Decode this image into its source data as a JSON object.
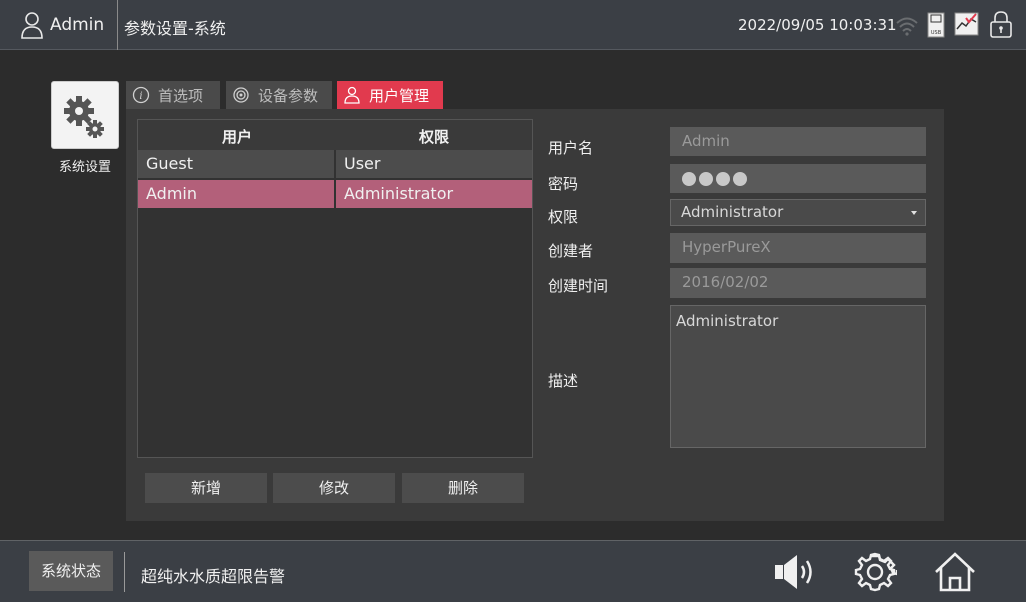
{
  "topbar": {
    "user_name": "Admin",
    "page_title": "参数设置-系统",
    "datetime": "2022/09/05 10:03:31",
    "icons": [
      "user-icon",
      "wifi-icon",
      "usb-icon",
      "chart-check-icon",
      "lock-icon"
    ]
  },
  "app_tile": {
    "label": "系统设置",
    "icon": "gears-icon"
  },
  "tabs": [
    {
      "label": "首选项",
      "icon": "info-icon",
      "active": false
    },
    {
      "label": "设备参数",
      "icon": "gear-icon",
      "active": false
    },
    {
      "label": "用户管理",
      "icon": "user-icon",
      "active": true
    }
  ],
  "table": {
    "headers": [
      "用户",
      "权限"
    ],
    "rows": [
      {
        "user": "Guest",
        "permission": "User",
        "selected": false
      },
      {
        "user": "Admin",
        "permission": "Administrator",
        "selected": true
      }
    ]
  },
  "actions": {
    "add": "新增",
    "edit": "修改",
    "delete": "删除"
  },
  "form": {
    "username_label": "用户名",
    "username_value": "Admin",
    "password_label": "密码",
    "password_dots": 4,
    "permission_label": "权限",
    "permission_value": "Administrator",
    "creator_label": "创建者",
    "creator_value": "HyperPureX",
    "created_time_label": "创建时间",
    "created_time_value": "2016/02/02",
    "description_label": "描述",
    "description_value": "Administrator"
  },
  "bottombar": {
    "status_button": "系统状态",
    "alarm_text": "超纯水水质超限告警",
    "icons": [
      "speaker-icon",
      "settings-icon",
      "home-icon"
    ]
  },
  "colors": {
    "accent": "#e13a4e",
    "selected_row": "#b3607a",
    "background": "#2c2c2c",
    "topbar": "#3b3f45"
  }
}
